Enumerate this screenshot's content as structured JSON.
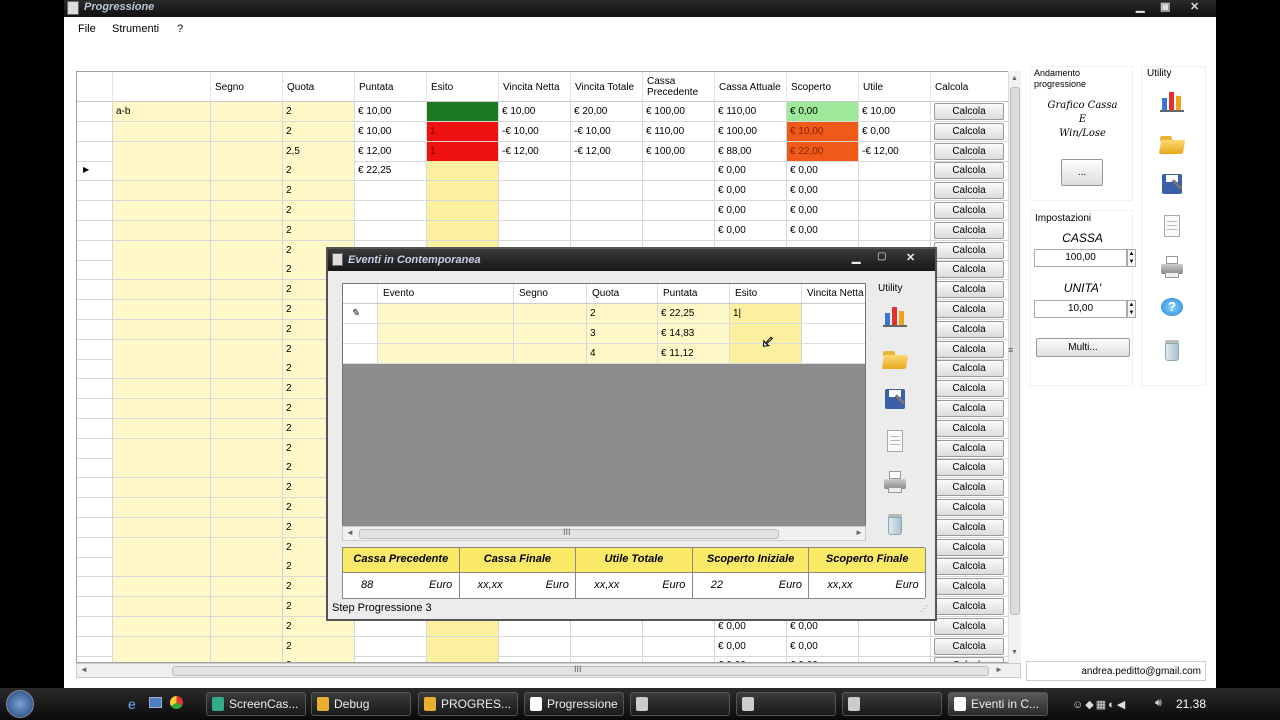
{
  "window": {
    "title": "Progressione"
  },
  "menu": [
    "File",
    "Strumenti",
    "?"
  ],
  "grid": {
    "headers": [
      "",
      "Segno",
      "Quota",
      "Puntata",
      "Esito",
      "Vincita Netta",
      "Vincita Totale",
      "Cassa Precedente",
      "Cassa Attuale",
      "Scoperto",
      "Utile",
      "Calcola"
    ],
    "button_label": "Calcola",
    "rows": [
      {
        "evento": "a-b",
        "quota": "2",
        "puntata": "€ 10,00",
        "esito": "1",
        "esito_color": "green",
        "vn": "€ 10,00",
        "vt": "€ 20,00",
        "cp": "€ 100,00",
        "ca": "€ 110,00",
        "sc": "€ 0,00",
        "sc_color": "lightgreen",
        "ut": "€ 10,00"
      },
      {
        "evento": "",
        "quota": "2",
        "puntata": "€ 10,00",
        "esito": "1",
        "esito_color": "red",
        "vn": "-€ 10,00",
        "vt": "-€ 10,00",
        "cp": "€ 110,00",
        "ca": "€ 100,00",
        "sc": "€ 10,00",
        "sc_color": "orange",
        "ut": "€ 0,00"
      },
      {
        "evento": "",
        "quota": "2,5",
        "puntata": "€ 12,00",
        "esito": "1",
        "esito_color": "red",
        "vn": "-€ 12,00",
        "vt": "-€ 12,00",
        "cp": "€ 100,00",
        "ca": "€ 88,00",
        "sc": "€ 22,00",
        "sc_color": "orange",
        "ut": "-€ 12,00"
      },
      {
        "evento": "",
        "quota": "2",
        "puntata": "€ 22,25",
        "esito": "",
        "vn": "",
        "vt": "",
        "cp": "",
        "ca": "€ 0,00",
        "sc": "€ 0,00",
        "ut": "",
        "current": true
      },
      {
        "evento": "",
        "quota": "2",
        "puntata": "",
        "esito": "",
        "vn": "",
        "vt": "",
        "cp": "",
        "ca": "€ 0,00",
        "sc": "€ 0,00",
        "ut": ""
      },
      {
        "evento": "",
        "quota": "2",
        "puntata": "",
        "esito": "",
        "vn": "",
        "vt": "",
        "cp": "",
        "ca": "€ 0,00",
        "sc": "€ 0,00",
        "ut": ""
      },
      {
        "evento": "",
        "quota": "2",
        "puntata": "",
        "esito": "",
        "vn": "",
        "vt": "",
        "cp": "",
        "ca": "€ 0,00",
        "sc": "€ 0,00",
        "ut": ""
      },
      {
        "quota": "2",
        "ca": "",
        "sc": ""
      },
      {
        "quota": "2"
      },
      {
        "quota": "2"
      },
      {
        "quota": "2"
      },
      {
        "quota": "2"
      },
      {
        "quota": "2"
      },
      {
        "quota": "2"
      },
      {
        "quota": "2"
      },
      {
        "quota": "2"
      },
      {
        "quota": "2"
      },
      {
        "quota": "2"
      },
      {
        "quota": "2"
      },
      {
        "quota": "2"
      },
      {
        "quota": "2"
      },
      {
        "quota": "2"
      },
      {
        "quota": "2"
      },
      {
        "quota": "2"
      },
      {
        "quota": "2"
      },
      {
        "quota": "2"
      },
      {
        "quota": "2",
        "ca": "€ 0,00",
        "sc": "€ 0,00"
      },
      {
        "quota": "2",
        "ca": "€ 0,00",
        "sc": "€ 0,00"
      },
      {
        "quota": "2",
        "ca": "€ 0,00",
        "sc": "€ 0,00"
      }
    ]
  },
  "scroll_label": "III",
  "side": {
    "andamento_label": "Andamento progressione",
    "grafico_lines": [
      "Grafico Cassa",
      "E",
      "Win/Lose"
    ],
    "grafico_button": "...",
    "impostazioni_label": "Impostazioni",
    "cassa_label": "CASSA",
    "cassa_value": "100,00",
    "unita_label": "UNITA'",
    "unita_value": "10,00",
    "multi_button": "Multi...",
    "utility_label": "Utility",
    "email": "andrea.peditto@gmail.com"
  },
  "dialog": {
    "title": "Eventi in Contemporanea",
    "headers": [
      "",
      "Evento",
      "Segno",
      "Quota",
      "Puntata",
      "Esito",
      "Vincita Netta"
    ],
    "rows": [
      {
        "quota": "2",
        "puntata": "€ 22,25",
        "esito": "1|"
      },
      {
        "quota": "3",
        "puntata": "€ 14,83",
        "esito": ""
      },
      {
        "quota": "4",
        "puntata": "€ 11,12",
        "esito": ""
      }
    ],
    "utility_label": "Utility",
    "summary_headers": [
      "Cassa Precedente",
      "Cassa Finale",
      "Utile Totale",
      "Scoperto Iniziale",
      "Scoperto Finale"
    ],
    "summary_values": [
      "88",
      "xx,xx",
      "xx,xx",
      "22",
      "xx,xx"
    ],
    "unit": "Euro",
    "status": "Step Progressione  3"
  },
  "taskbar": {
    "items": [
      "ScreenCas...",
      "Debug",
      "PROGRES...",
      "Progressione",
      "",
      "",
      "",
      "Eventi in C..."
    ],
    "time": "21.38"
  }
}
